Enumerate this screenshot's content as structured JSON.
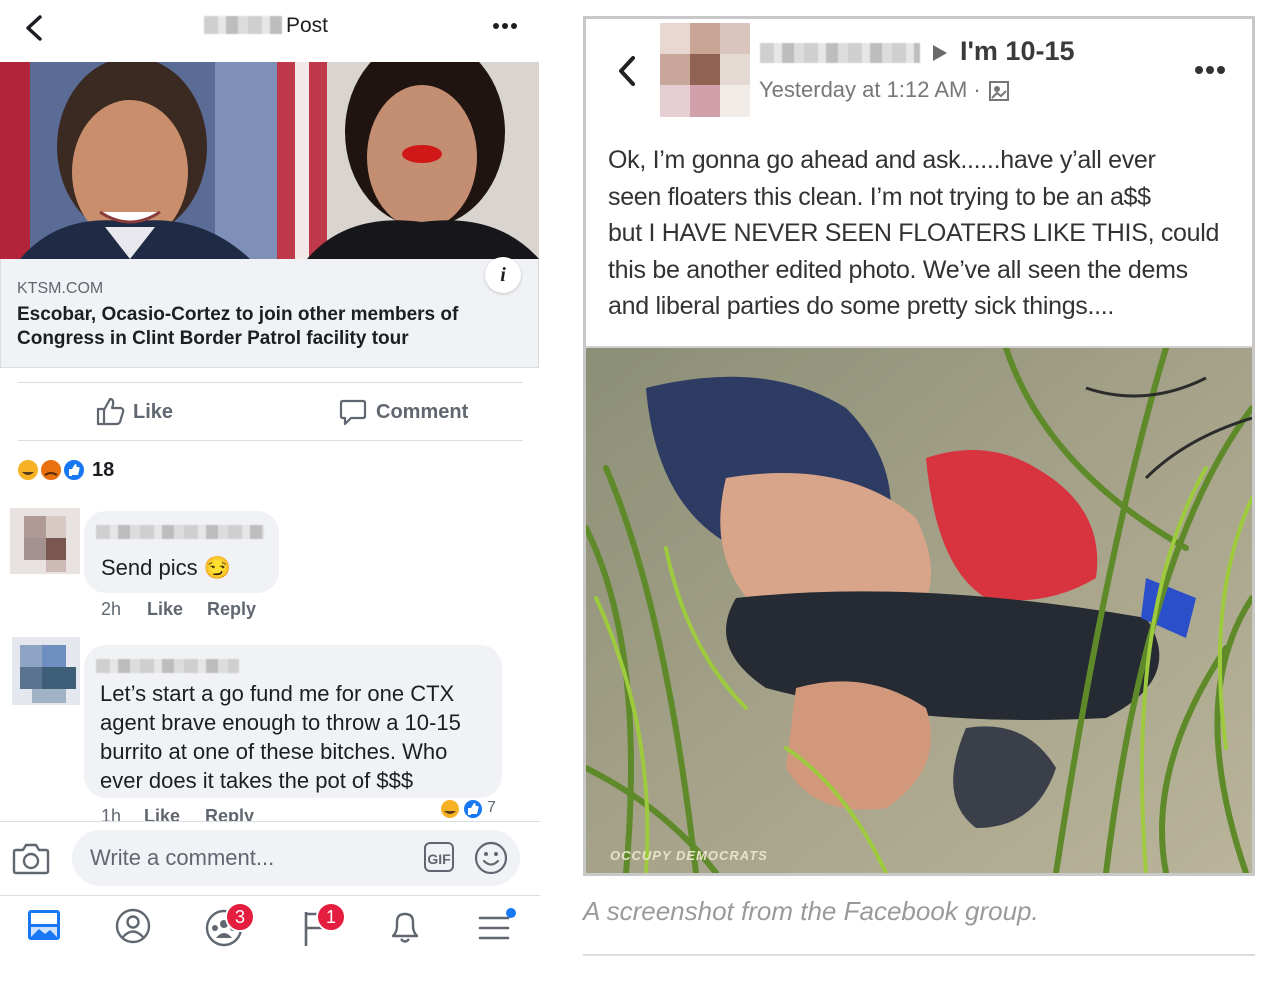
{
  "left": {
    "header": {
      "title": "Post",
      "more_icon": "more-icon",
      "back_icon": "chevron-left-icon"
    },
    "link": {
      "source": "KTSM.COM",
      "headline": "Escobar, Ocasio-Cortez to join other members of Congress in Clint Border Patrol facility tour",
      "info_icon": "info-icon"
    },
    "actions": {
      "like": "Like",
      "comment": "Comment"
    },
    "reactions": {
      "count": "18"
    },
    "comments": [
      {
        "text": "Send pics 😏",
        "time": "2h",
        "like": "Like",
        "reply": "Reply"
      },
      {
        "text": "Let’s start a go fund me for one CTX agent brave enough to throw a 10-15 burrito at one of these bitches. Who ever does it takes the pot of $$$",
        "time": "1h",
        "like": "Like",
        "reply": "Reply",
        "reaction_count": "7"
      }
    ],
    "composer": {
      "placeholder": "Write a comment...",
      "gif": "GIF"
    },
    "nav": {
      "groups_badge": "3",
      "events_badge": "1"
    }
  },
  "right": {
    "group": "I'm 10-15",
    "time": "Yesterday at 1:12 AM ·",
    "post_lines": [
      "Ok, I’m gonna go ahead and ask......have y’all ever",
      "seen floaters this clean.  I’m not trying to be an a$$",
      "but I HAVE NEVER SEEN FLOATERS LIKE THIS,  could",
      "this be another edited photo.  We’ve all seen the dems",
      "and liberal parties do some pretty sick things...."
    ],
    "watermark": "OCCUPY DEMOCRATS",
    "caption": "A screenshot from the Facebook group."
  },
  "colors": {
    "fb_blue": "#1877f2",
    "badge_red": "#e41e3f",
    "gray_text": "#606770"
  }
}
